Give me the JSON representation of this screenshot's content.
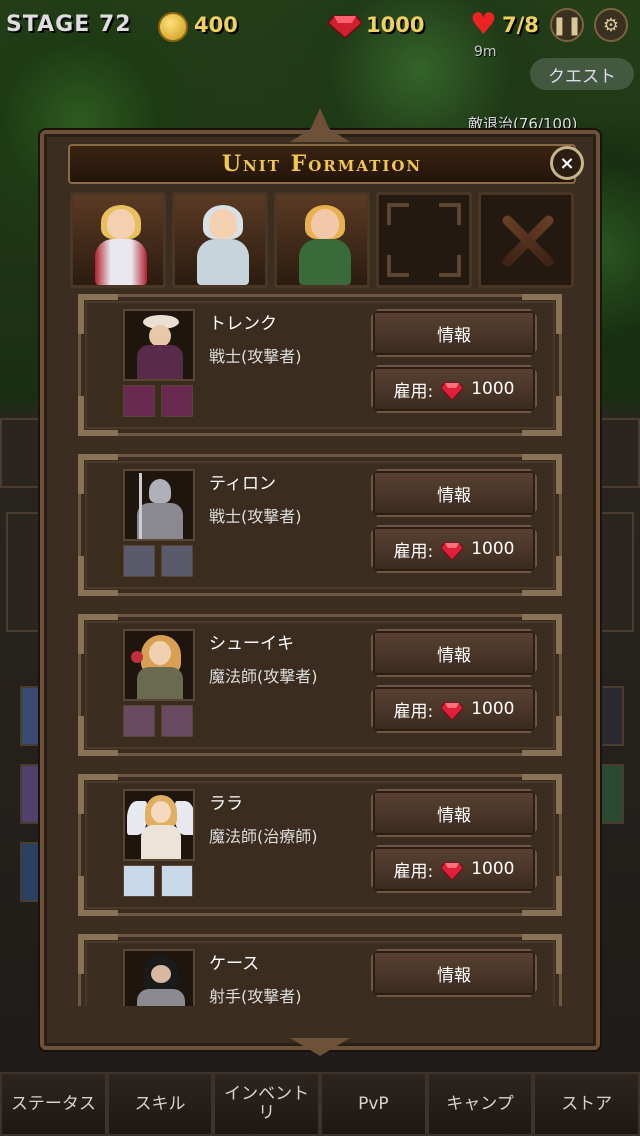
{
  "hud": {
    "stage": "STAGE 72",
    "gold": "400",
    "gems": "1000",
    "lives": "7/8",
    "timer": "9m",
    "pause_icon": "pause-icon",
    "settings_icon": "gear-icon",
    "quest_label": "クエスト",
    "quest_progress": "敵退治(76/100)"
  },
  "modal": {
    "title": "Unit Formation",
    "close_label": "×",
    "party_slots": [
      {
        "state": "filled",
        "unit": "knight-girl"
      },
      {
        "state": "filled",
        "unit": "priestess-girl"
      },
      {
        "state": "filled",
        "unit": "ranger-girl"
      },
      {
        "state": "empty"
      },
      {
        "state": "remove"
      }
    ],
    "info_label": "情報",
    "hire_label": "雇用:",
    "units": [
      {
        "name": "トレンク",
        "class": "戦士(攻撃者)",
        "cost": "1000",
        "colors": [
          "#5a3a50",
          "#c9a070"
        ]
      },
      {
        "name": "ティロン",
        "class": "戦士(攻撃者)",
        "cost": "1000",
        "colors": [
          "#8a8a8a",
          "#c8a080"
        ]
      },
      {
        "name": "シューイキ",
        "class": "魔法師(攻撃者)",
        "cost": "1000",
        "colors": [
          "#7a6a50",
          "#e0b070"
        ]
      },
      {
        "name": "ララ",
        "class": "魔法師(治療師)",
        "cost": "1000",
        "colors": [
          "#d8d0c0",
          "#f0c080"
        ]
      },
      {
        "name": "ケース",
        "class": "射手(攻撃者)",
        "cost": ""
      }
    ]
  },
  "nav": [
    "ステータス",
    "スキル",
    "インベント\nリ",
    "PvP",
    "キャンプ",
    "ストア"
  ],
  "colors": {
    "gold": "#f0c850",
    "gem_red": "#e0203a",
    "frame_brown": "#6d5138"
  }
}
